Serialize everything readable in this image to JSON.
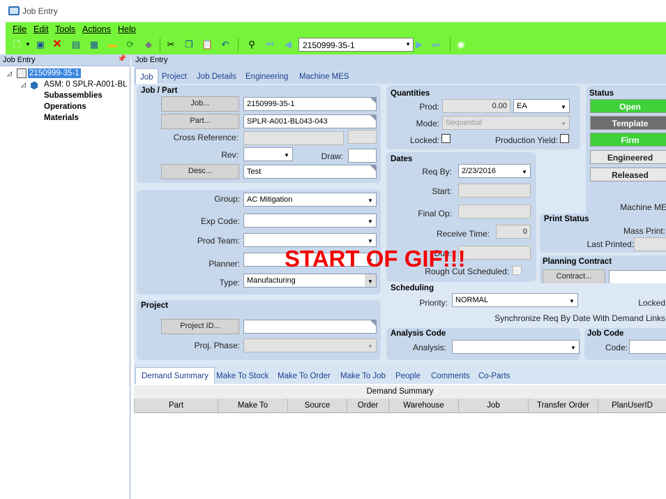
{
  "window": {
    "title": "Job Entry"
  },
  "menu": [
    "File",
    "Edit",
    "Tools",
    "Actions",
    "Help"
  ],
  "toolbar": {
    "job_selector": "2150999-35-1"
  },
  "left_panel": {
    "header": "Job Entry",
    "tree": {
      "root": "2150999-35-1",
      "asm": "ASM: 0 SPLR-A001-BL",
      "children": [
        "Subassemblies",
        "Operations",
        "Materials"
      ]
    }
  },
  "right_header": "Job Entry",
  "tabs": [
    "Job",
    "Project",
    "Job Details",
    "Engineering",
    "Machine MES"
  ],
  "job_part": {
    "title": "Job / Part",
    "job_btn": "Job...",
    "job_value": "2150999-35-1",
    "part_btn": "Part...",
    "part_value": "SPLR-A001-BL043-043",
    "cross_ref_label": "Cross Reference:",
    "rev_label": "Rev:",
    "draw_label": "Draw:",
    "desc_btn": "Desc...",
    "desc_value": "Test"
  },
  "group_panel": {
    "group_label": "Group:",
    "group_value": "AC Mitigation",
    "exp_label": "Exp Code:",
    "prod_team_label": "Prod Team:",
    "planner_label": "Planner:",
    "type_label": "Type:",
    "type_value": "Manufacturing"
  },
  "project": {
    "title": "Project",
    "project_btn": "Project ID...",
    "phase_label": "Proj. Phase:"
  },
  "quantities": {
    "title": "Quantities",
    "prod_label": "Prod:",
    "prod_value": "0.00",
    "uom": "EA",
    "mode_label": "Mode:",
    "mode_value": "Sequential",
    "locked_label": "Locked:",
    "yield_label": "Production Yield:"
  },
  "dates": {
    "title": "Dates",
    "req_by_label": "Req By:",
    "req_by_value": "2/23/2016",
    "start_label": "Start:",
    "final_op_label": "Final Op:",
    "receive_label": "Receive Time:",
    "receive_value": "0",
    "due_label": "Due:",
    "rough_cut_label": "Rough Cut Scheduled:"
  },
  "status": {
    "title": "Status",
    "buttons": [
      {
        "label": "Open",
        "color": "#3fd13a"
      },
      {
        "label": "Template",
        "color": "#6e6e6e"
      },
      {
        "label": "Firm",
        "color": "#3fd13a"
      },
      {
        "label": "Engineered",
        "color": "#e8e8e8"
      },
      {
        "label": "Released",
        "color": "#e8e8e8"
      }
    ],
    "machine_mes": "Machine MES"
  },
  "print_status": {
    "title": "Print Status",
    "mass_print": "Mass Print:",
    "last_printed": "Last Printed:"
  },
  "planning_contract": {
    "title": "Planning Contract",
    "contract_btn": "Contract..."
  },
  "scheduling": {
    "title": "Scheduling",
    "priority_label": "Priority:",
    "priority_value": "NORMAL",
    "locked_label": "Locked",
    "sync_label": "Synchronize Req By Date With Demand Links"
  },
  "analysis": {
    "title": "Analysis Code",
    "analysis_label": "Analysis:"
  },
  "job_code": {
    "title": "Job Code",
    "code_label": "Code:"
  },
  "bottom_tabs": [
    "Demand Summary",
    "Make To Stock",
    "Make To Order",
    "Make To Job",
    "People",
    "Comments",
    "Co-Parts"
  ],
  "grid": {
    "title": "Demand Summary",
    "columns": [
      "Part",
      "Make To",
      "Source",
      "Order",
      "Warehouse",
      "Job",
      "Transfer Order",
      "PlanUserID"
    ]
  },
  "overlay_text": "START OF GIF!!!"
}
